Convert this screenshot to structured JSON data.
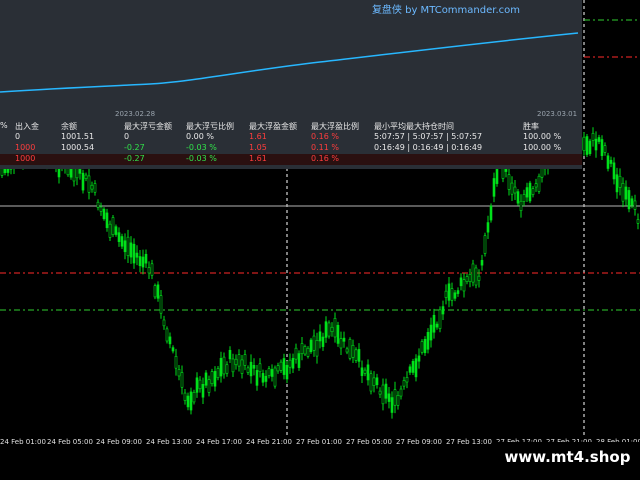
{
  "window": {
    "brand": "复盘侠 by MTCommander.com"
  },
  "equity_panel": {
    "date_left": "2023.02.28",
    "date_right": "2023.03.01",
    "line_color": "#27b7ff",
    "bg_color": "#2a2f36"
  },
  "stats_table": {
    "headers": [
      "%",
      "出入金",
      "余额",
      "最大浮亏金额",
      "最大浮亏比例",
      "最大浮盈金额",
      "最大浮盈比例",
      "最小平均最大持仓时间",
      "胜率"
    ],
    "rows": [
      [
        "",
        "0",
        "1001.51",
        "0",
        "0.00 %",
        "1.61",
        "0.16 %",
        "5:07:57 | 5:07:57 | 5:07:57",
        "100.00 %"
      ],
      [
        "",
        "1000",
        "1000.54",
        "-0.27",
        "-0.03 %",
        "1.05",
        "0.11 %",
        "0:16:49 | 0:16:49 | 0:16:49",
        "100.00 %"
      ],
      [
        "",
        "1000",
        "",
        "-0.27",
        "-0.03 %",
        "1.61",
        "0.16 %",
        "",
        ""
      ]
    ]
  },
  "time_axis": {
    "ticks": [
      "24 Feb 01:00",
      "24 Feb 05:00",
      "24 Feb 09:00",
      "24 Feb 13:00",
      "24 Feb 17:00",
      "24 Feb 21:00",
      "27 Feb 01:00",
      "27 Feb 05:00",
      "27 Feb 09:00",
      "27 Feb 13:00",
      "27 Feb 17:00",
      "27 Feb 21:00",
      "28 Feb 01:00"
    ]
  },
  "colors": {
    "bull_candle": "#00e01a",
    "grid_vertical": "#ffffff",
    "level_red": "#ff2a2a",
    "level_green": "#31ce31",
    "level_white": "#b4b4b4"
  },
  "watermark": {
    "text": "www.mt4.shop"
  }
}
